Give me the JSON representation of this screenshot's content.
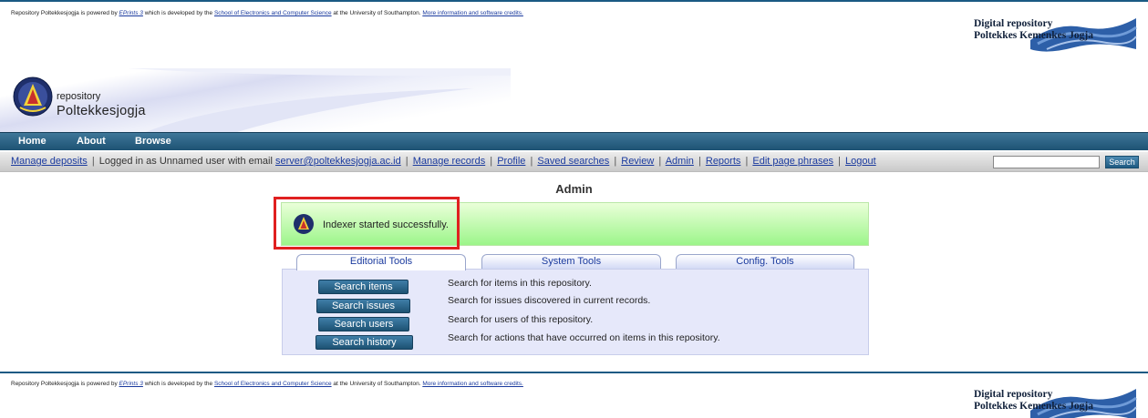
{
  "credits": {
    "prefix": "Repository Poltekkesjogja is powered by",
    "eprints_link": "EPrints 3",
    "middle1": "which is developed by the",
    "school_link": "School of Electronics and Computer Science",
    "middle2": "at the University of Southampton.",
    "info_link": "More information and software credits."
  },
  "badge": {
    "line1": "Digital repository",
    "line2": "Poltekkes Kemenkes Jogja"
  },
  "logo": {
    "line1": "repository",
    "line2": "Poltekkesjogja"
  },
  "nav": {
    "home": "Home",
    "about": "About",
    "browse": "Browse"
  },
  "keytools": {
    "manage_deposits": "Manage deposits",
    "logged_in_text": "Logged in as Unnamed user with email",
    "email": "server@poltekkesjogja.ac.id",
    "manage_records": "Manage records",
    "profile": "Profile",
    "saved_searches": "Saved searches",
    "review": "Review",
    "admin": "Admin",
    "reports": "Reports",
    "edit_phrases": "Edit page phrases",
    "logout": "Logout",
    "sep": "|",
    "search_value": "",
    "search_button": "Search"
  },
  "page": {
    "title": "Admin",
    "message": "Indexer started successfully."
  },
  "tabs": [
    {
      "label": "Editorial Tools",
      "active": true
    },
    {
      "label": "System Tools",
      "active": false
    },
    {
      "label": "Config. Tools",
      "active": false
    }
  ],
  "tools": [
    {
      "button": "Search items",
      "description": "Search for items in this repository."
    },
    {
      "button": "Search issues",
      "description": "Search for issues discovered in current records."
    },
    {
      "button": "Search users",
      "description": "Search for users of this repository."
    },
    {
      "button": "Search history",
      "description": "Search for actions that have occurred on items in this repository."
    }
  ],
  "colors": {
    "nav_bar": "#1d5273",
    "message_bg": "#9cf58a",
    "highlight": "#e02020",
    "link": "#1a3a9e"
  }
}
